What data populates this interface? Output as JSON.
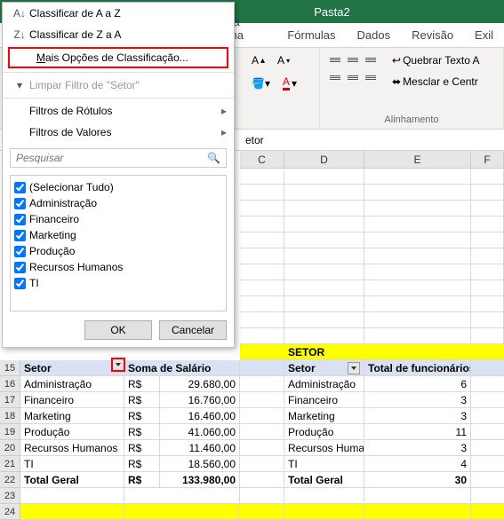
{
  "titlebar": {
    "doc_name": "Pasta2"
  },
  "ribbon_tabs": {
    "layout": "out da Página",
    "formulas": "Fórmulas",
    "data": "Dados",
    "review": "Revisão",
    "view": "Exil"
  },
  "ribbon": {
    "wrap_text": "Quebrar Texto A",
    "merge_center": "Mesclar e Centr",
    "alignment_label": "Alinhamento",
    "font_size_up": "A",
    "font_size_down": "A"
  },
  "formula_bar": {
    "content": "etor"
  },
  "columns": {
    "C": "C",
    "D": "D",
    "E": "E",
    "F": "F"
  },
  "filter_menu": {
    "sort_asc": "Classificar de A a Z",
    "sort_desc": "Classificar de Z a A",
    "more_sort": "Mais Opções de Classificação...",
    "clear_filter": "Limpar Filtro de \"Setor\"",
    "label_filters": "Filtros de Rótulos",
    "value_filters": "Filtros de Valores",
    "search_placeholder": "Pesquisar",
    "items": [
      "(Selecionar Tudo)",
      "Administração",
      "Financeiro",
      "Marketing",
      "Produção",
      "Recursos Humanos",
      "TI"
    ],
    "ok": "OK",
    "cancel": "Cancelar"
  },
  "yellow_header_right": "SETOR",
  "table_left": {
    "headers": {
      "setor": "Setor",
      "sum": "Soma de Salário"
    },
    "rows": [
      {
        "n": "16",
        "setor": "Administração",
        "cur": "R$",
        "val": "29.680,00"
      },
      {
        "n": "17",
        "setor": "Financeiro",
        "cur": "R$",
        "val": "16.760,00"
      },
      {
        "n": "18",
        "setor": "Marketing",
        "cur": "R$",
        "val": "16.460,00"
      },
      {
        "n": "19",
        "setor": "Produção",
        "cur": "R$",
        "val": "41.060,00"
      },
      {
        "n": "20",
        "setor": "Recursos Humanos",
        "cur": "R$",
        "val": "11.460,00"
      },
      {
        "n": "21",
        "setor": "TI",
        "cur": "R$",
        "val": "18.560,00"
      }
    ],
    "total": {
      "n": "22",
      "label": "Total Geral",
      "cur": "R$",
      "val": "133.980,00"
    }
  },
  "table_right": {
    "headers": {
      "setor": "Setor",
      "total": "Total de funcionários"
    },
    "rows": [
      {
        "setor": "Administração",
        "val": "6"
      },
      {
        "setor": "Financeiro",
        "val": "3"
      },
      {
        "setor": "Marketing",
        "val": "3"
      },
      {
        "setor": "Produção",
        "val": "11"
      },
      {
        "setor": "Recursos Humanos",
        "val": "3"
      },
      {
        "setor": "TI",
        "val": "4"
      }
    ],
    "total": {
      "label": "Total Geral",
      "val": "30"
    }
  },
  "row_nums": [
    "15",
    "16",
    "17",
    "18",
    "19",
    "20",
    "21",
    "22",
    "23",
    "24"
  ]
}
